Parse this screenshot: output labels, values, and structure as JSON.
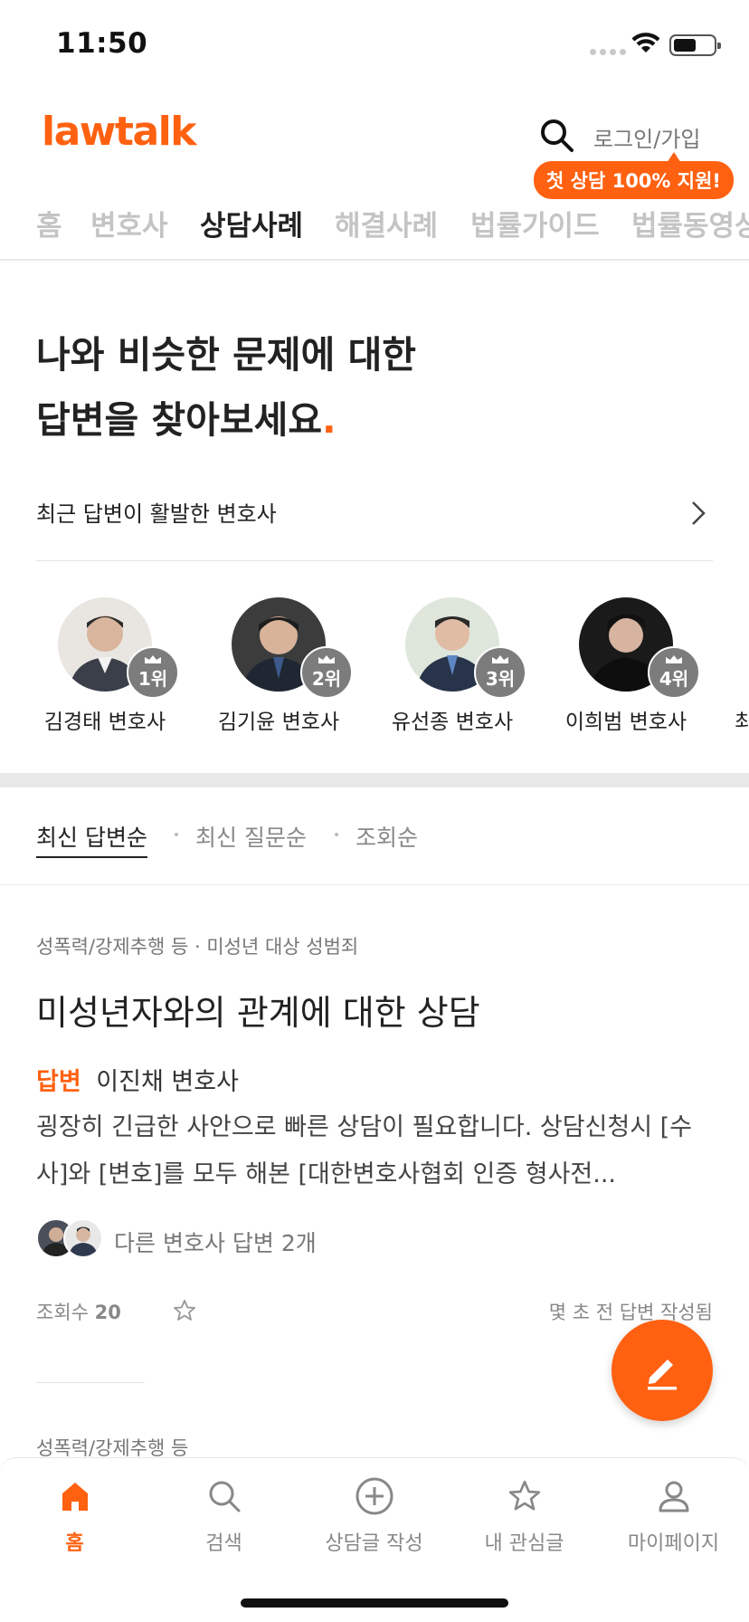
{
  "status_bar": {
    "time": "11:50"
  },
  "header": {
    "logo": "lawtalk",
    "login": "로그인/가입",
    "promo": "첫 상담 100% 지원!"
  },
  "nav_tabs": [
    {
      "label": "홈",
      "active": false
    },
    {
      "label": "변호사",
      "active": false
    },
    {
      "label": "상담사례",
      "active": true
    },
    {
      "label": "해결사례",
      "active": false
    },
    {
      "label": "법률가이드",
      "active": false
    },
    {
      "label": "법률동영상",
      "active": false
    }
  ],
  "hero": {
    "line1": "나와 비슷한 문제에 대한",
    "line2": "답변을 찾아보세요",
    "dot": "."
  },
  "active_lawyers": {
    "title": "최근 답변이 활발한 변호사",
    "items": [
      {
        "name": "김경태 변호사",
        "rank": "1위"
      },
      {
        "name": "김기윤 변호사",
        "rank": "2위"
      },
      {
        "name": "유선종 변호사",
        "rank": "3위"
      },
      {
        "name": "이희범 변호사",
        "rank": "4위"
      },
      {
        "name": "최"
      }
    ]
  },
  "sort_options": [
    {
      "label": "최신 답변순",
      "active": true
    },
    {
      "label": "최신 질문순",
      "active": false
    },
    {
      "label": "조회순",
      "active": false
    }
  ],
  "post": {
    "category": "성폭력/강제추행 등 · 미성년 대상 성범죄",
    "title": "미성년자와의 관계에 대한 상담",
    "answer_tag": "답변",
    "answer_lawyer": "이진채 변호사",
    "answer_text": "굉장히 긴급한 사안으로 빠른 상담이 필요합니다. 상담신청시 [수사]와 [변호]를 모두 해본 [대한변호사협회 인증 형사전...",
    "other_answers": "다른 변호사 답변 2개",
    "views_label": "조회수",
    "views_count": "20",
    "time": "몇 초 전 답변 작성됨"
  },
  "next_post": {
    "category": "성폭력/강제추행 등"
  },
  "tab_bar": [
    {
      "label": "홈",
      "icon": "home-icon",
      "active": true
    },
    {
      "label": "검색",
      "icon": "search-icon",
      "active": false
    },
    {
      "label": "상담글 작성",
      "icon": "plus-circle-icon",
      "active": false
    },
    {
      "label": "내 관심글",
      "icon": "star-icon",
      "active": false
    },
    {
      "label": "마이페이지",
      "icon": "user-icon",
      "active": false
    }
  ],
  "colors": {
    "accent": "#ff6111",
    "text": "#222222",
    "muted": "#888888"
  }
}
